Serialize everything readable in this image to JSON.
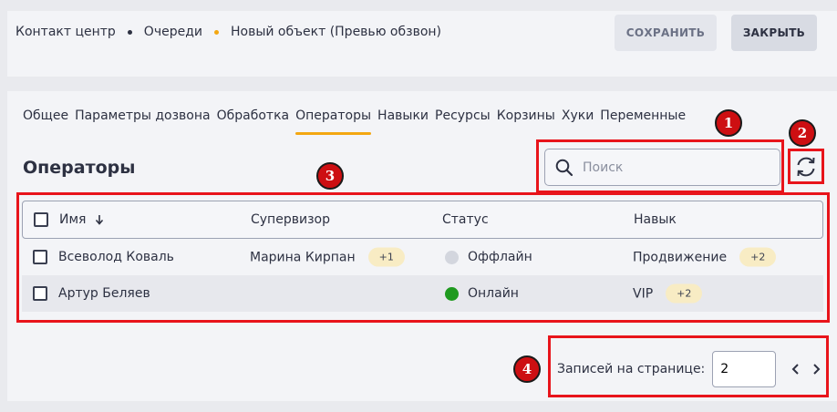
{
  "breadcrumb": {
    "items": [
      "Контакт центр",
      "Очереди",
      "Новый объект (Превью обзвон)"
    ],
    "separator_colors": [
      "#2d3142",
      "#f3a712"
    ]
  },
  "toolbar": {
    "save_label": "Сохранить",
    "close_label": "Закрыть"
  },
  "tabs": [
    {
      "label": "Общее",
      "active": false
    },
    {
      "label": "Параметры дозвона",
      "active": false
    },
    {
      "label": "Обработка",
      "active": false
    },
    {
      "label": "Операторы",
      "active": true
    },
    {
      "label": "Навыки",
      "active": false
    },
    {
      "label": "Ресурсы",
      "active": false
    },
    {
      "label": "Корзины",
      "active": false
    },
    {
      "label": "Хуки",
      "active": false
    },
    {
      "label": "Переменные",
      "active": false
    }
  ],
  "section_title": "Операторы",
  "search": {
    "placeholder": "Поиск",
    "value": ""
  },
  "table": {
    "columns": [
      "Имя",
      "Супервизор",
      "Статус",
      "Навык"
    ],
    "sort_icon": "arrow-down-icon",
    "rows": [
      {
        "name": "Всеволод Коваль",
        "supervisor": "Марина Кирпан",
        "supervisor_extra": "+1",
        "status": "Оффлайн",
        "status_color": "#d3d6de",
        "skill": "Продвижение",
        "skill_extra": "+2"
      },
      {
        "name": "Артур Беляев",
        "supervisor": "",
        "supervisor_extra": "",
        "status": "Онлайн",
        "status_color": "#1f9a1f",
        "skill": "VIP",
        "skill_extra": "+2"
      }
    ]
  },
  "pagination": {
    "label": "Записей на странице:",
    "value": "2"
  },
  "annotations": [
    {
      "label": "1"
    },
    {
      "label": "2"
    },
    {
      "label": "3"
    },
    {
      "label": "4"
    }
  ],
  "colors": {
    "accent": "#f3a712",
    "annotation": "#e8141b",
    "online": "#1f9a1f",
    "offline": "#d3d6de",
    "pill": "#f8ecc4"
  }
}
